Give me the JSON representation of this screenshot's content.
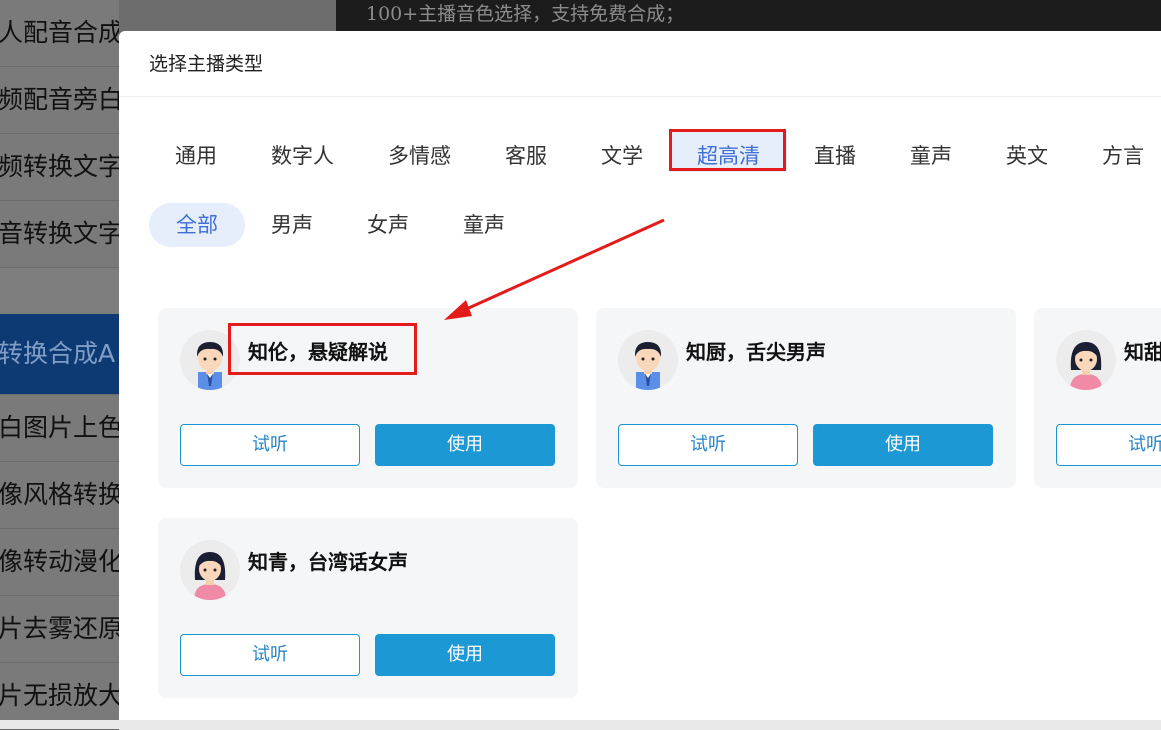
{
  "background": {
    "sidebar_items": [
      "人配音合成",
      "频配音旁白",
      "频转换文字",
      "音转换文字",
      "转换合成A",
      "白图片上色",
      "像风格转换",
      "像转动漫化",
      "片去雾还原",
      "片无损放大"
    ],
    "code_line": "100+主播音色选择，支持免费合成；"
  },
  "modal": {
    "title": "选择主播类型",
    "tabs": [
      "通用",
      "数字人",
      "多情感",
      "客服",
      "文学",
      "超高清",
      "直播",
      "童声",
      "英文",
      "方言"
    ],
    "active_tab": "超高清",
    "sub_tabs": [
      "全部",
      "男声",
      "女声",
      "童声"
    ],
    "active_sub_tab": "全部",
    "cards": [
      {
        "name": "知伦，悬疑解说",
        "avatar": "male-avatar-icon"
      },
      {
        "name": "知厨，舌尖男声",
        "avatar": "male-avatar-icon"
      },
      {
        "name": "知甜",
        "avatar": "female-avatar-icon"
      },
      {
        "name": "知青，台湾话女声",
        "avatar": "female-avatar-icon"
      }
    ],
    "listen_label": "试听",
    "use_label": "使用"
  },
  "colors": {
    "accent": "#3f6fd6",
    "button": "#1c99d4",
    "highlight": "#e31b1b"
  }
}
